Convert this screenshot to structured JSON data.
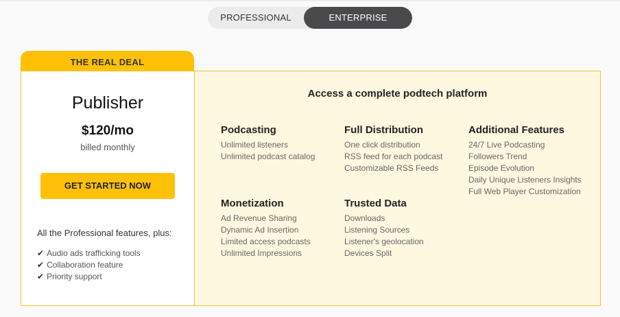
{
  "toggle": {
    "options": [
      "PROFESSIONAL",
      "ENTERPRISE"
    ],
    "selected": "ENTERPRISE"
  },
  "tab_label": "THE REAL DEAL",
  "plan": {
    "name": "Publisher",
    "price": "$120/mo",
    "billing": "billed monthly",
    "cta_label": "GET STARTED NOW",
    "plus_text": "All the Professional features, plus:",
    "features": [
      "Audio ads trafficking tools",
      "Collaboration feature",
      "Priority support"
    ],
    "check_glyph": "✔"
  },
  "panel": {
    "title": "Access a complete podtech platform",
    "groups": [
      {
        "title": "Podcasting",
        "items": [
          "Unlimited listeners",
          "Unlimited podcast catalog"
        ]
      },
      {
        "title": "Full Distribution",
        "items": [
          "One click distribution",
          "RSS feed for each podcast",
          "Customizable RSS Feeds"
        ]
      },
      {
        "title": "Additional Features",
        "items": [
          "24/7 Live Podcasting",
          "Followers Trend",
          "Episode Evolution",
          "Daily Unique Listeners Insights",
          "Full Web Player Customization"
        ]
      },
      {
        "title": "Monetization",
        "items": [
          "Ad Revenue Sharing",
          "Dynamic Ad Insertion",
          "Limited access podcasts",
          "Unlimited Impressions"
        ]
      },
      {
        "title": "Trusted Data",
        "items": [
          "Downloads",
          "Listening Sources",
          "Listener's geolocation",
          "Devices Split"
        ]
      }
    ]
  },
  "colors": {
    "accent": "#ffc107",
    "panel_bg": "#fff8e1",
    "toggle_active": "#4a4a4c"
  }
}
